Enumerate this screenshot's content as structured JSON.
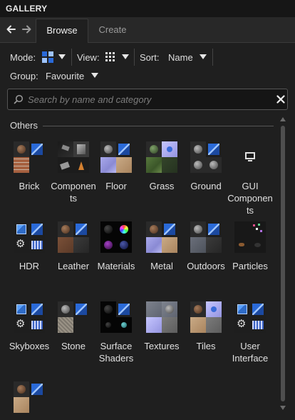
{
  "window": {
    "title": "GALLERY"
  },
  "tabs": [
    {
      "label": "Browse",
      "active": true
    },
    {
      "label": "Create",
      "active": false
    }
  ],
  "options": {
    "mode_label": "Mode:",
    "view_label": "View:",
    "sort_label": "Sort:",
    "sort_value": "Name",
    "group_label": "Group:",
    "group_value": "Favourite"
  },
  "search": {
    "placeholder": "Search by name and category",
    "value": ""
  },
  "section": {
    "label": "Others"
  },
  "items": [
    {
      "label": "Brick",
      "thumb": "brick"
    },
    {
      "label": "Components",
      "thumb": "components"
    },
    {
      "label": "Floor",
      "thumb": "floor"
    },
    {
      "label": "Grass",
      "thumb": "grass"
    },
    {
      "label": "Ground",
      "thumb": "ground"
    },
    {
      "label": "GUI Components",
      "thumb": "gui"
    },
    {
      "label": "HDR",
      "thumb": "hdr"
    },
    {
      "label": "Leather",
      "thumb": "leather"
    },
    {
      "label": "Materials",
      "thumb": "materials"
    },
    {
      "label": "Metal",
      "thumb": "metal"
    },
    {
      "label": "Outdoors",
      "thumb": "outdoors"
    },
    {
      "label": "Particles",
      "thumb": "particles"
    },
    {
      "label": "Skyboxes",
      "thumb": "skyboxes"
    },
    {
      "label": "Stone",
      "thumb": "stone"
    },
    {
      "label": "Surface Shaders",
      "thumb": "surface"
    },
    {
      "label": "Textures",
      "thumb": "textures"
    },
    {
      "label": "Tiles",
      "thumb": "tiles"
    },
    {
      "label": "User Interface",
      "thumb": "ui"
    },
    {
      "label": "",
      "thumb": "brick2"
    }
  ],
  "icons": {
    "back": "arrow-left-icon",
    "forward": "arrow-right-icon",
    "mode": "thumbnail-mode-icon",
    "view": "grid-view-icon",
    "search": "search-icon",
    "clear": "close-icon"
  },
  "colors": {
    "background": "#1f1f1f",
    "accent_blue": "#2a6ad8"
  }
}
